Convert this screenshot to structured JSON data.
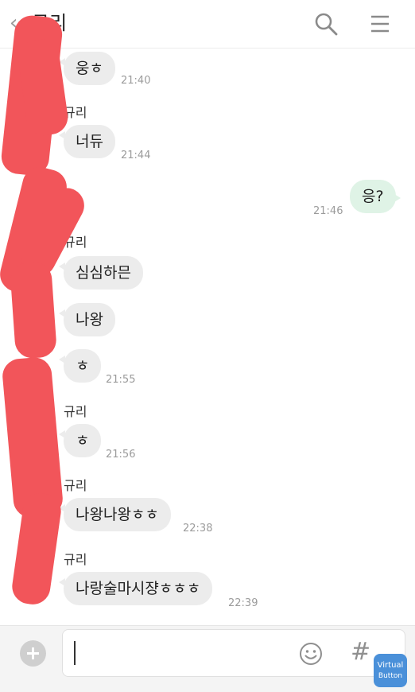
{
  "header": {
    "back_glyph": "‹",
    "title": "규리"
  },
  "messages": [
    {
      "text": "웅ㅎ",
      "time": "21:40"
    },
    {
      "sender": "규리",
      "text": "너듀",
      "time": "21:44"
    },
    {
      "text": "응?",
      "time": "21:46"
    },
    {
      "sender": "규리",
      "text": "심심하믄"
    },
    {
      "text": "나왕"
    },
    {
      "text": "ㅎ",
      "time": "21:55"
    },
    {
      "sender": "규리",
      "text": "ㅎ",
      "time": "21:56"
    },
    {
      "sender": "규리",
      "text": "나왕나왕ㅎㅎ",
      "time": "22:38"
    },
    {
      "sender": "규리",
      "text": "나랑술마시쟝ㅎㅎㅎ",
      "time": "22:39"
    }
  ],
  "partial_top_name": "규리",
  "input": {
    "hash_glyph": "#"
  },
  "virtual_button": {
    "line1": "Virtual",
    "line2": "Button"
  },
  "colors": {
    "redaction": "#f2555a",
    "my_bubble": "#dff3e6",
    "their_bubble": "#ececec"
  }
}
